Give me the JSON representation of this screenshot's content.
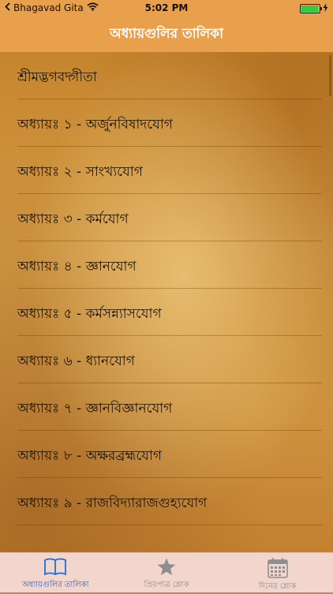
{
  "status": {
    "back_app": "Bhagavad Gita",
    "time": "5:02 PM",
    "battery_level": 0.95,
    "battery_color": "#2ecc40"
  },
  "nav": {
    "title": "অধ্যায়গুলির তালিকা"
  },
  "list": {
    "items": [
      "শ্রীমদ্ভগবদ্গীতা",
      "অধ্যায়ঃ ১ - অর্জুনবিষাদযোগ",
      "অধ্যায়ঃ ২ - সাংখ্যযোগ",
      "অধ্যায়ঃ ৩ - কর্মযোগ",
      "অধ্যায়ঃ ৪ - জ্ঞানযোগ",
      "অধ্যায়ঃ ৫ - কর্মসন্ন্যাসযোগ",
      "অধ্যায়ঃ ৬ - ধ্যানযোগ",
      "অধ্যায়ঃ ৭ - জ্ঞানবিজ্ঞানযোগ",
      "অধ্যায়ঃ ৮ - অক্ষরব্রহ্মযোগ",
      "অধ্যায়ঃ ৯ - রাজবিদ্যারাজগুহ্যযোগ"
    ]
  },
  "tabs": [
    {
      "label": "অধ্যায়গুলির তালিকা",
      "icon": "book-icon",
      "active": true
    },
    {
      "label": "প্রিয়পাত্র শ্লোক",
      "icon": "star-icon",
      "active": false
    },
    {
      "label": "দিনের শ্লোক",
      "icon": "calendar-icon",
      "active": false
    }
  ],
  "colors": {
    "nav_background": "#e9a04c",
    "tab_active": "#1e6fd9",
    "tab_inactive": "#8e8e8e",
    "tab_background": "#f2d6cd"
  }
}
